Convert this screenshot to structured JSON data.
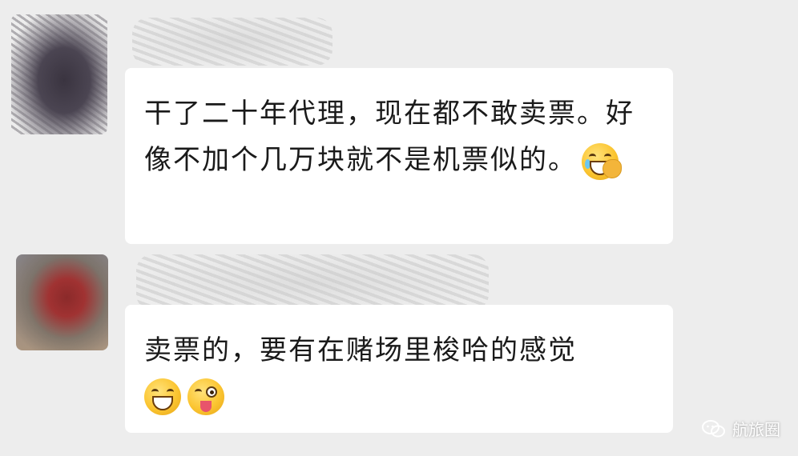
{
  "messages": [
    {
      "text": "干了二十年代理，现在都不敢卖票。好像不加个几万块就不是机票似的。",
      "emojis": [
        "facepalm-laugh-emoji"
      ]
    },
    {
      "text": "卖票的，要有在赌场里梭哈的感觉",
      "emojis": [
        "grin-emoji",
        "wink-tongue-emoji"
      ]
    }
  ],
  "watermark": {
    "label": "航旅圈",
    "icon": "wechat-icon"
  },
  "colors": {
    "background": "#ededed",
    "bubble": "#ffffff",
    "text": "#1a1a1a"
  }
}
